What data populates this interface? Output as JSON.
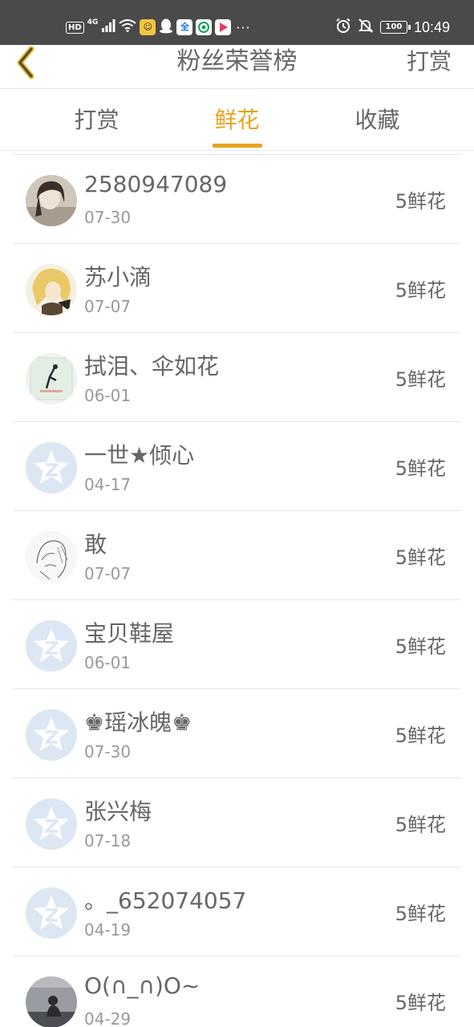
{
  "status_bar": {
    "hd": "HD",
    "network": "4G",
    "app_quanmin": "全",
    "more": "···",
    "battery": "100",
    "time": "10:49"
  },
  "nav": {
    "title": "粉丝荣誉榜",
    "right_action": "打赏"
  },
  "tabs": [
    {
      "label": "打赏",
      "active": false
    },
    {
      "label": "鲜花",
      "active": true
    },
    {
      "label": "收藏",
      "active": false
    }
  ],
  "colors": {
    "accent": "#e8a21e",
    "text": "#666666",
    "subtext": "#999999",
    "status_bar": "#4a4a4a",
    "default_avatar": "#dde7f3"
  },
  "rows": [
    {
      "name": "2580947089",
      "date": "07-30",
      "amount": "5鲜花",
      "avatar": "photo-girl"
    },
    {
      "name": "苏小滴",
      "date": "07-07",
      "amount": "5鲜花",
      "avatar": "anime-girl"
    },
    {
      "name": "拭泪、伞如花",
      "date": "06-01",
      "amount": "5鲜花",
      "avatar": "ink-figure"
    },
    {
      "name": "一世★倾心",
      "date": "04-17",
      "amount": "5鲜花",
      "avatar": "default-qzone"
    },
    {
      "name": "敢",
      "date": "07-07",
      "amount": "5鲜花",
      "avatar": "sketch"
    },
    {
      "name": "宝贝鞋屋",
      "date": "06-01",
      "amount": "5鲜花",
      "avatar": "default-qzone"
    },
    {
      "name": "♚瑶冰魄♚",
      "date": "07-30",
      "amount": "5鲜花",
      "avatar": "default-qzone"
    },
    {
      "name": "张兴梅",
      "date": "07-18",
      "amount": "5鲜花",
      "avatar": "default-qzone"
    },
    {
      "name": "。_652074057",
      "date": "04-19",
      "amount": "5鲜花",
      "avatar": "default-qzone"
    },
    {
      "name": "O(∩_∩)O~",
      "date": "04-29",
      "amount": "5鲜花",
      "avatar": "dark-photo"
    }
  ]
}
